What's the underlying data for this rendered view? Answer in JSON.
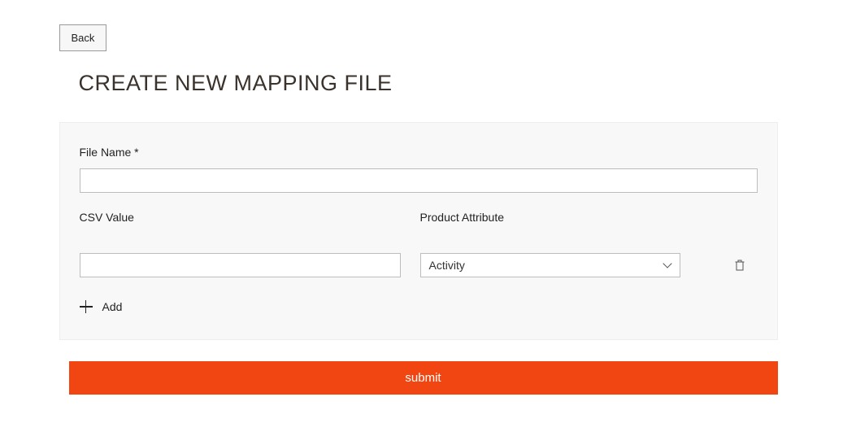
{
  "back_button": "Back",
  "page_title": "CREATE NEW MAPPING FILE",
  "form": {
    "file_name_label": "File Name *",
    "file_name_value": "",
    "csv_value_label": "CSV Value",
    "product_attribute_label": "Product Attribute",
    "rows": [
      {
        "csv_value": "",
        "attribute_selected": "Activity"
      }
    ],
    "add_label": "Add"
  },
  "submit_label": "submit"
}
